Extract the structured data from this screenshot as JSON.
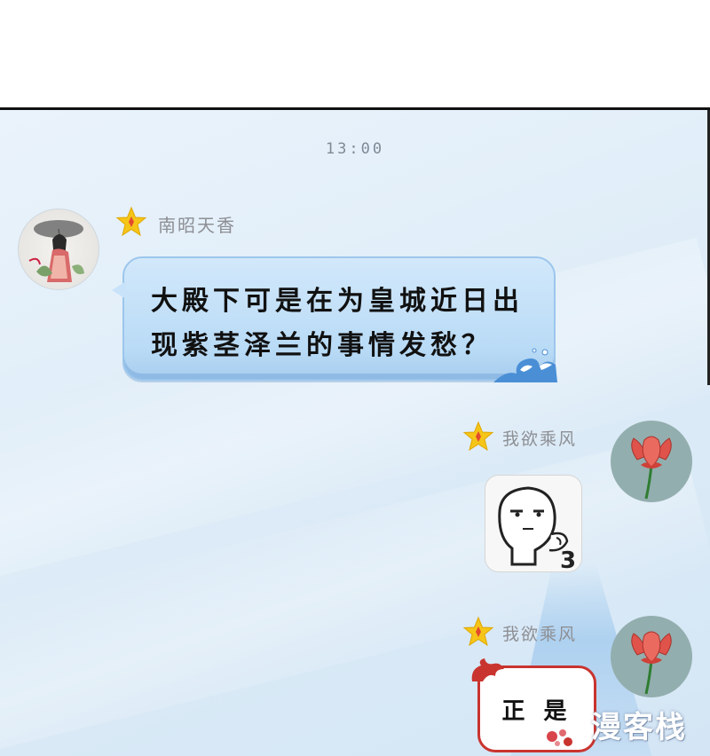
{
  "header": {
    "time": "13:00"
  },
  "messages": [
    {
      "sender": "南昭天香",
      "side": "left",
      "text_line1": "大殿下可是在为皇城近日出",
      "text_line2": "现紫茎泽兰的事情发愁？"
    },
    {
      "sender": "我欲乘风",
      "side": "right",
      "sticker": "pointing-face-sticker"
    },
    {
      "sender": "我欲乘风",
      "side": "right",
      "text": "正 是"
    }
  ],
  "watermark": "漫客栈",
  "colors": {
    "background": "#dcebf7",
    "bubble_blue": "#b9dbf6",
    "bubble_red_border": "#c9342f",
    "star": "#f5c518",
    "lotus": "#e0534a"
  }
}
